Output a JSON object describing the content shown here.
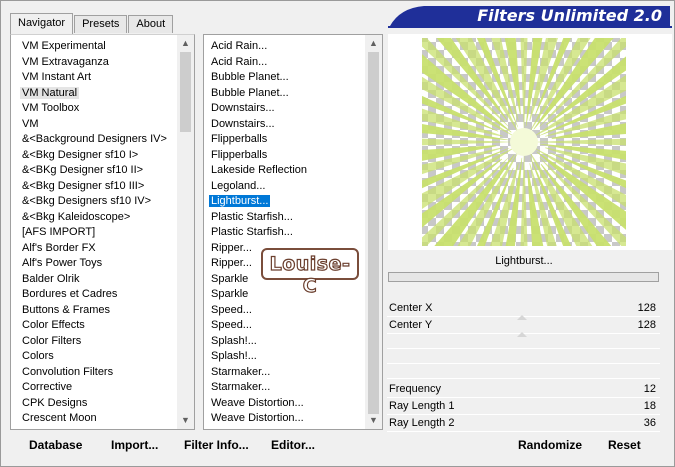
{
  "window": {
    "banner_title": "Filters Unlimited 2.0",
    "accent_color": "#1f2f99"
  },
  "tabs": [
    {
      "label": "Navigator",
      "active": true
    },
    {
      "label": "Presets",
      "active": false
    },
    {
      "label": "About",
      "active": false
    }
  ],
  "categories": {
    "selected": "VM Natural",
    "items": [
      "VM Experimental",
      "VM Extravaganza",
      "VM Instant Art",
      "VM Natural",
      "VM Toolbox",
      "VM",
      "&<Background Designers IV>",
      "&<Bkg Designer sf10 I>",
      "&<BKg Designer sf10 II>",
      "&<Bkg Designer sf10 III>",
      "&<Bkg Designers sf10 IV>",
      "&<Bkg Kaleidoscope>",
      "[AFS IMPORT]",
      "Alf's Border FX",
      "Alf's Power Toys",
      "Balder Olrik",
      "Bordures et Cadres",
      "Buttons & Frames",
      "Color Effects",
      "Color Filters",
      "Colors",
      "Convolution Filters",
      "Corrective",
      "CPK Designs",
      "Crescent Moon"
    ]
  },
  "filters": {
    "selected": "Lightburst...",
    "items": [
      "Acid Rain...",
      "Acid Rain...",
      "Bubble Planet...",
      "Bubble Planet...",
      "Downstairs...",
      "Downstairs...",
      "Flipperballs",
      "Flipperballs",
      "Lakeside Reflection",
      "Legoland...",
      "Lightburst...",
      "Plastic Starfish...",
      "Plastic Starfish...",
      "Ripper...",
      "Ripper...",
      "Sparkle",
      "Sparkle",
      "Speed...",
      "Speed...",
      "Splash!...",
      "Splash!...",
      "Starmaker...",
      "Starmaker...",
      "Weave Distortion...",
      "Weave Distortion..."
    ]
  },
  "preview": {
    "filter_name": "Lightburst...",
    "ray_color": "#c8e06e"
  },
  "params_top": [
    {
      "name": "Center X",
      "value": "128"
    },
    {
      "name": "Center Y",
      "value": "128"
    }
  ],
  "params_bottom": [
    {
      "name": "Frequency",
      "value": "12"
    },
    {
      "name": "Ray Length 1",
      "value": "18"
    },
    {
      "name": "Ray Length 2",
      "value": "36"
    }
  ],
  "buttons": {
    "database": "Database",
    "import": "Import...",
    "filter_info": "Filter Info...",
    "editor": "Editor...",
    "randomize": "Randomize",
    "reset": "Reset"
  },
  "watermark": "Louise-C"
}
